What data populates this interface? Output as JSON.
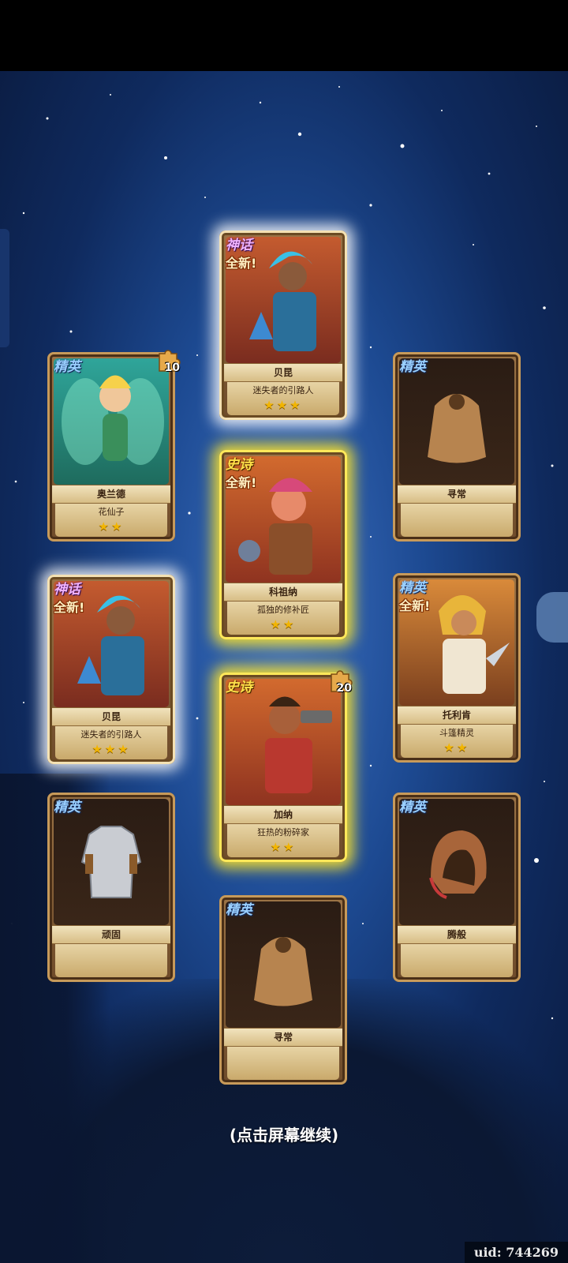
{
  "hint": "(点击屏幕继续)",
  "uid_label": "uid: 744269",
  "new_label": "全新!",
  "cards": {
    "fairy": {
      "rarity": "精英",
      "name": "奥兰德",
      "title": "花仙子",
      "stars": "★★",
      "fragments": "10"
    },
    "bell1": {
      "rarity": "神话",
      "name": "贝昆",
      "title": "迷失者的引路人",
      "stars": "★★★"
    },
    "bag1": {
      "rarity": "精英",
      "name": "寻常"
    },
    "kezu": {
      "rarity": "史诗",
      "name": "科祖纳",
      "title": "孤独的修补匠",
      "stars": "★★"
    },
    "bell2": {
      "rarity": "神话",
      "name": "贝昆",
      "title": "迷失者的引路人",
      "stars": "★★★"
    },
    "toli": {
      "rarity": "精英",
      "name": "托利肯",
      "title": "斗篷精灵",
      "stars": "★★"
    },
    "gana": {
      "rarity": "史诗",
      "name": "加纳",
      "title": "狂热的粉碎家",
      "stars": "★★",
      "fragments": "20"
    },
    "armor": {
      "rarity": "精英",
      "name": "顽固"
    },
    "hood": {
      "rarity": "精英",
      "name": "腾般"
    },
    "bag2": {
      "rarity": "精英",
      "name": "寻常"
    }
  }
}
